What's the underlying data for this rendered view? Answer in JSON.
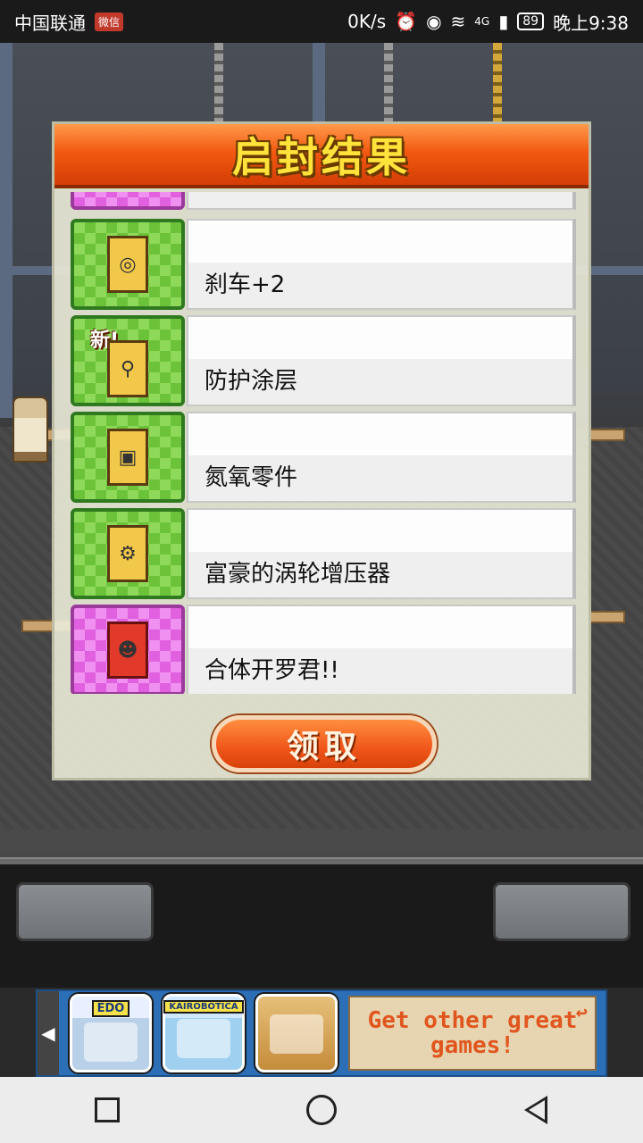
{
  "status_bar": {
    "carrier": "中国联通",
    "carrier_badge": "微信",
    "speed": "0K/s",
    "network": "4G",
    "battery": "89",
    "time": "晚上9:38"
  },
  "dialog": {
    "title": "启封结果",
    "items": [
      {
        "label": "刹车+2",
        "icon": "brake-disc-icon",
        "new": false
      },
      {
        "label": "防护涂层",
        "icon": "spray-gun-icon",
        "new": true,
        "new_label": "新!"
      },
      {
        "label": "氮氧零件",
        "icon": "nitro-tank-icon",
        "new": false
      },
      {
        "label": "富豪的涡轮增压器",
        "icon": "turbocharger-icon",
        "new": false
      },
      {
        "label": "合体开罗君!!",
        "icon": "kairo-character-icon",
        "new": false
      }
    ],
    "collect_button": "领取"
  },
  "ad": {
    "games": [
      {
        "name": "EDO"
      },
      {
        "name": "KAIROBOTICA"
      },
      {
        "name": ""
      }
    ],
    "cta": "Get other great games!"
  }
}
